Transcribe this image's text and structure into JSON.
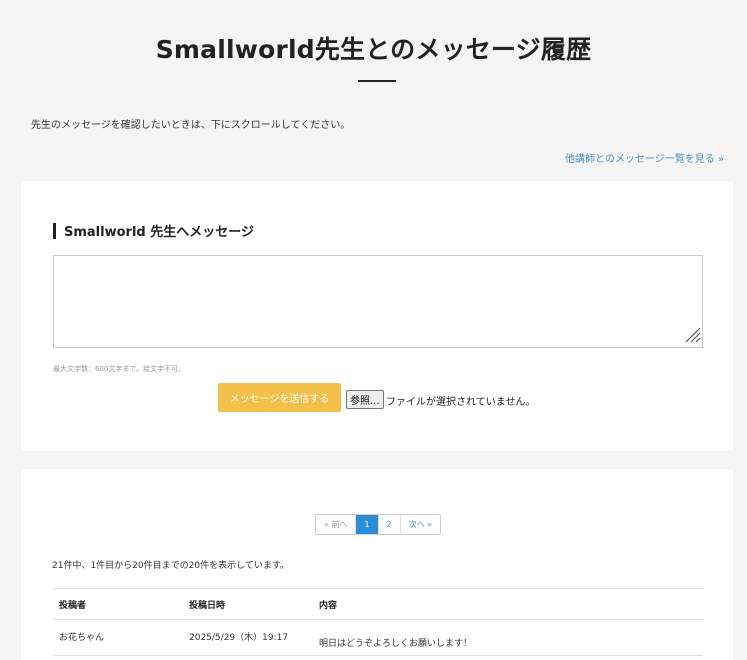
{
  "header": {
    "title": "Smallworld先生とのメッセージ履歴",
    "intro": "先生のメッセージを確認したいときは、下にスクロールしてください。",
    "other_teachers_link": "他講師とのメッセージ一覧を見る »"
  },
  "compose": {
    "heading": "Smallworld 先生へメッセージ",
    "message_value": "",
    "hint": "最大文字数：600文字まで。絵文字不可。",
    "send_label": "メッセージを送信する",
    "browse_label": "参照...",
    "file_status": "ファイルが選択されていません。",
    "accent_color": "#f5c04a"
  },
  "history": {
    "pagination": {
      "prev": "« 前へ",
      "pages": [
        "1",
        "2"
      ],
      "current": "1",
      "next": "次へ »"
    },
    "summary": "21件中、1件目から20件目までの20件を表示しています。",
    "columns": [
      "投稿者",
      "投稿日時",
      "内容"
    ],
    "rows": [
      {
        "author": "お花ちゃん",
        "datetime": "2025/5/29（木）19:17",
        "content": "明日はどうぞよろしくお願いします！"
      }
    ]
  }
}
